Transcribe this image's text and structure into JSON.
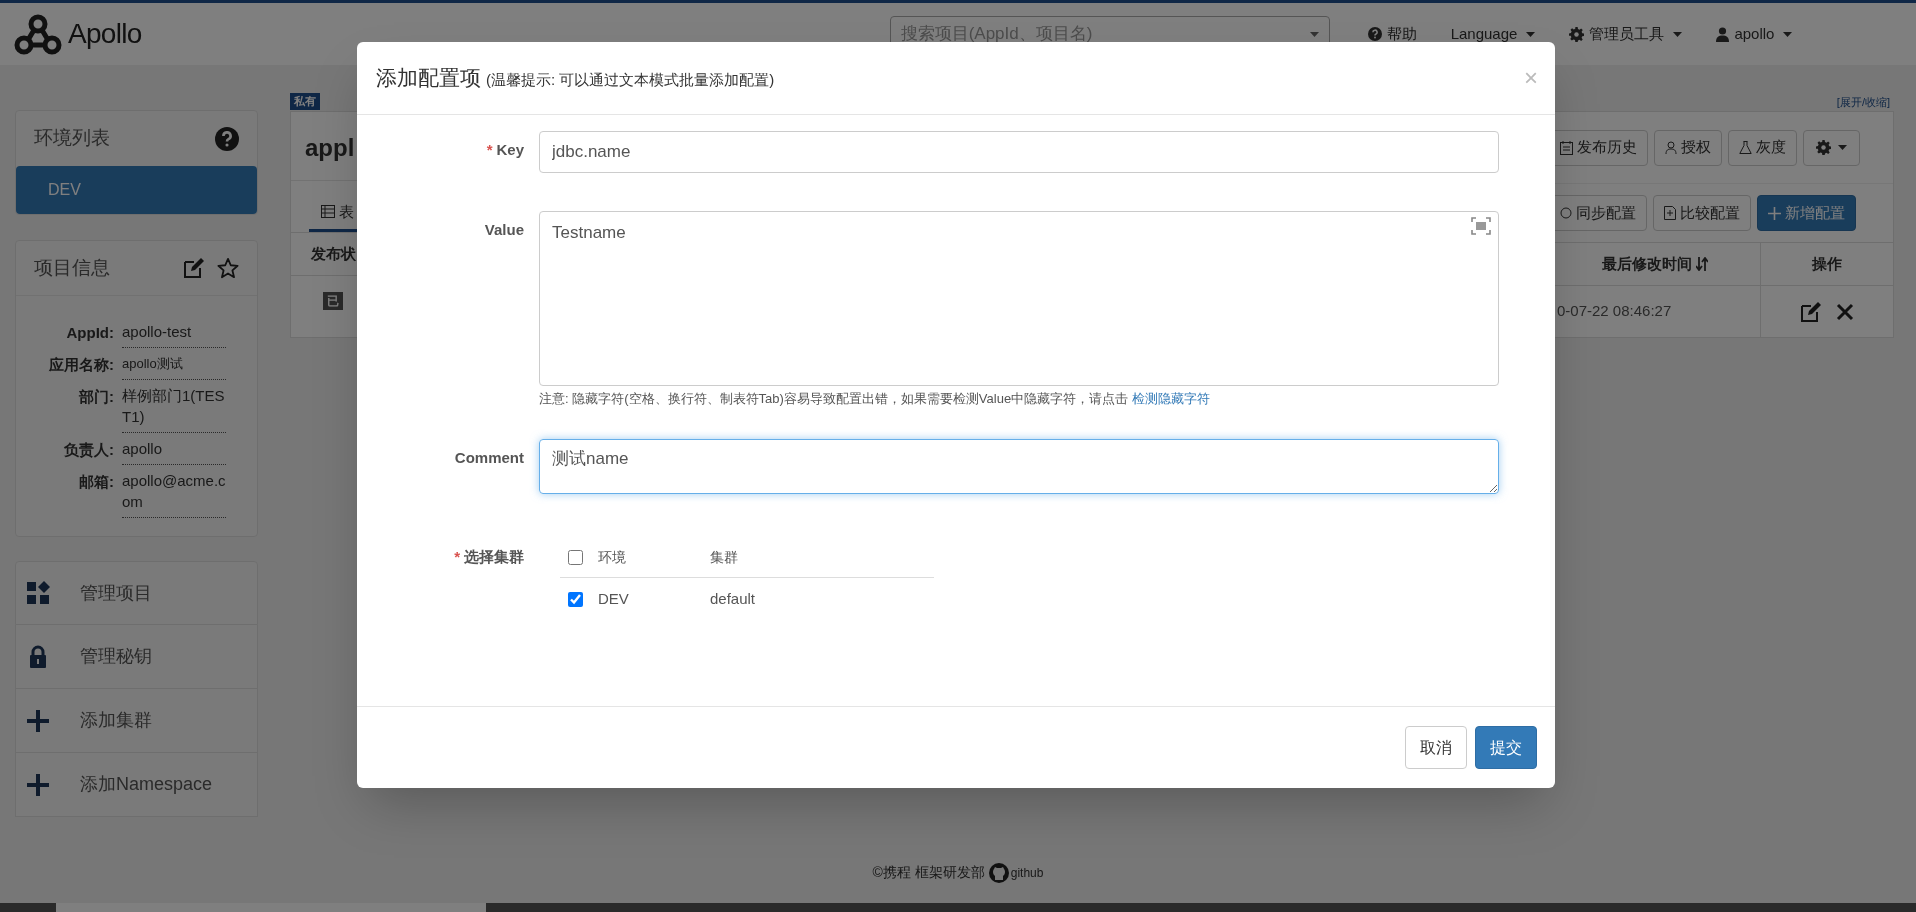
{
  "nav": {
    "brand": "Apollo",
    "search_placeholder": "搜索项目(AppId、项目名)",
    "menu": [
      {
        "label": "帮助",
        "kind": "help"
      },
      {
        "label": "Language",
        "kind": "dropdown"
      },
      {
        "label": "管理员工具",
        "kind": "tools"
      },
      {
        "label": "apollo",
        "kind": "user"
      }
    ]
  },
  "sidebar": {
    "env_panel": {
      "title": "环境列表",
      "items": [
        {
          "label": "DEV",
          "selected": true
        }
      ]
    },
    "info_panel": {
      "title": "项目信息",
      "fields": [
        {
          "label": "AppId:",
          "value": "apollo-test",
          "small": false
        },
        {
          "label": "应用名称:",
          "value": "apollo测试",
          "small": true
        },
        {
          "label": "部门:",
          "value": "样例部门1(TEST1)",
          "small": false
        },
        {
          "label": "负责人:",
          "value": "apollo",
          "small": false
        },
        {
          "label": "邮箱:",
          "value": "apollo@acme.com",
          "small": false
        }
      ]
    },
    "actions": [
      {
        "label": "管理项目",
        "kind": "manage"
      },
      {
        "label": "管理秘钥",
        "kind": "lock"
      },
      {
        "label": "添加集群",
        "kind": "add"
      },
      {
        "label": "添加Namespace",
        "kind": "add"
      }
    ]
  },
  "namespace": {
    "badge": "私有",
    "title": "appl",
    "tab": "表",
    "column": "发布状",
    "status": "已",
    "expand_link": "[展开/收缩]",
    "toolbar": [
      {
        "label": "发布历史",
        "kind": "history"
      },
      {
        "label": "授权",
        "kind": "auth"
      },
      {
        "label": "灰度",
        "kind": "gray"
      },
      {
        "kind": "settings"
      }
    ],
    "actions": [
      {
        "label": "同步配置",
        "kind": "sync",
        "primary": false
      },
      {
        "label": "比较配置",
        "kind": "compare",
        "primary": false
      },
      {
        "label": "新增配置",
        "kind": "add",
        "primary": true
      }
    ],
    "columns": [
      {
        "label": "最后修改时间",
        "sortable": true
      },
      {
        "label": "操作",
        "sortable": false
      }
    ],
    "rows": [
      {
        "modified": "0-07-22 08:46:27"
      }
    ]
  },
  "modal": {
    "title": "添加配置项",
    "subtitle": "(温馨提示: 可以通过文本模式批量添加配置)",
    "close": "×",
    "key": {
      "marker": "*",
      "label": "Key",
      "value": "jdbc.name"
    },
    "value": {
      "label": "Value",
      "value": "Testname"
    },
    "hint": "注意: 隐藏字符(空格、换行符、制表符Tab)容易导致配置出错，如果需要检测Value中隐藏字符，请点击 ",
    "hint_link": "检测隐藏字符",
    "comment": {
      "label": "Comment",
      "value": "测试name",
      "focused": true
    },
    "clusters": {
      "marker": "*",
      "label": "选择集群",
      "columns": [
        "环境",
        "集群"
      ],
      "all_checked": false,
      "rows": [
        {
          "env": "DEV",
          "cluster": "default",
          "checked": true
        }
      ]
    },
    "buttons": [
      {
        "label": "取消",
        "kind": "default"
      },
      {
        "label": "提交",
        "kind": "primary"
      }
    ]
  },
  "footer": {
    "org": "©携程 框架研发部",
    "link": "github"
  }
}
